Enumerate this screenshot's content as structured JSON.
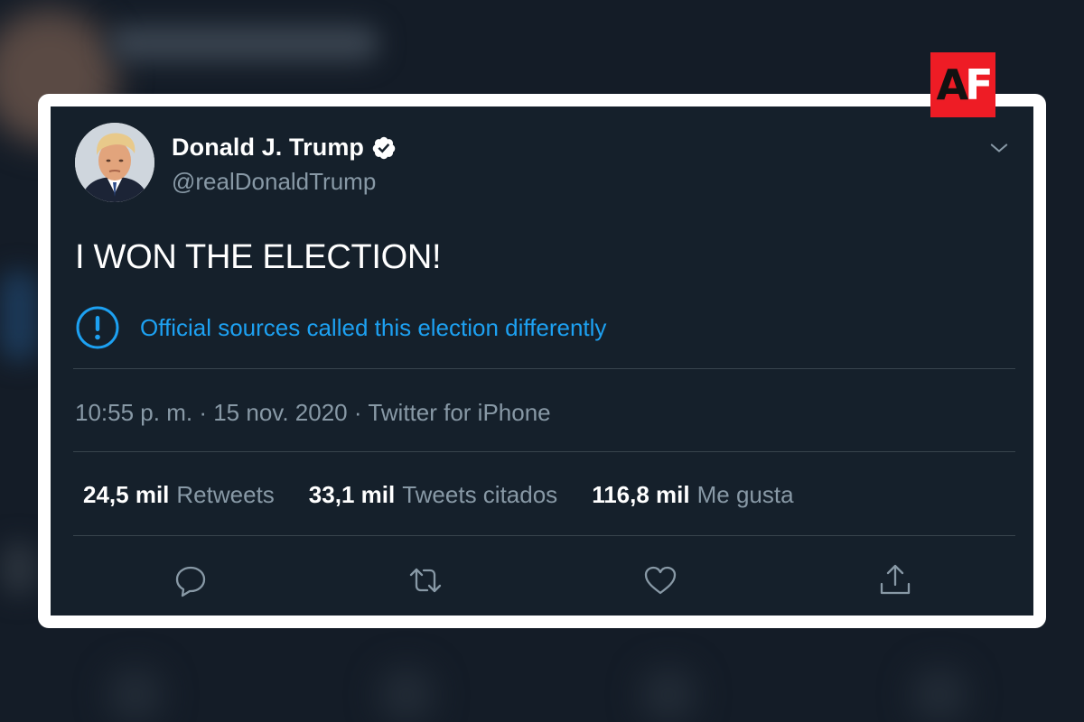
{
  "tweet": {
    "display_name": "Donald J. Trump",
    "handle": "@realDonaldTrump",
    "text": "I WON THE ELECTION!",
    "notice": "Official sources called this election differently",
    "time": "10:55 p. m.",
    "separator": "·",
    "date": "15 nov. 2020",
    "source": "Twitter for iPhone",
    "stats": [
      {
        "count": "24,5 mil",
        "label": "Retweets"
      },
      {
        "count": "33,1 mil",
        "label": "Tweets citados"
      },
      {
        "count": "116,8 mil",
        "label": "Me gusta"
      }
    ],
    "icons": {
      "verified": "verified-badge-icon",
      "menu": "chevron-down-icon",
      "notice": "exclamation-circle-icon",
      "reply": "reply-icon",
      "retweet": "retweet-icon",
      "like": "heart-icon",
      "share": "share-icon"
    }
  },
  "logo": {
    "letter_a": "A",
    "letter_f": "F"
  },
  "colors": {
    "card_background": "#15202b",
    "frame": "#ffffff",
    "text_primary": "#ffffff",
    "text_secondary": "#8899a6",
    "accent": "#1da1f2",
    "divider": "#38444d",
    "logo_red": "#ee1c25"
  }
}
